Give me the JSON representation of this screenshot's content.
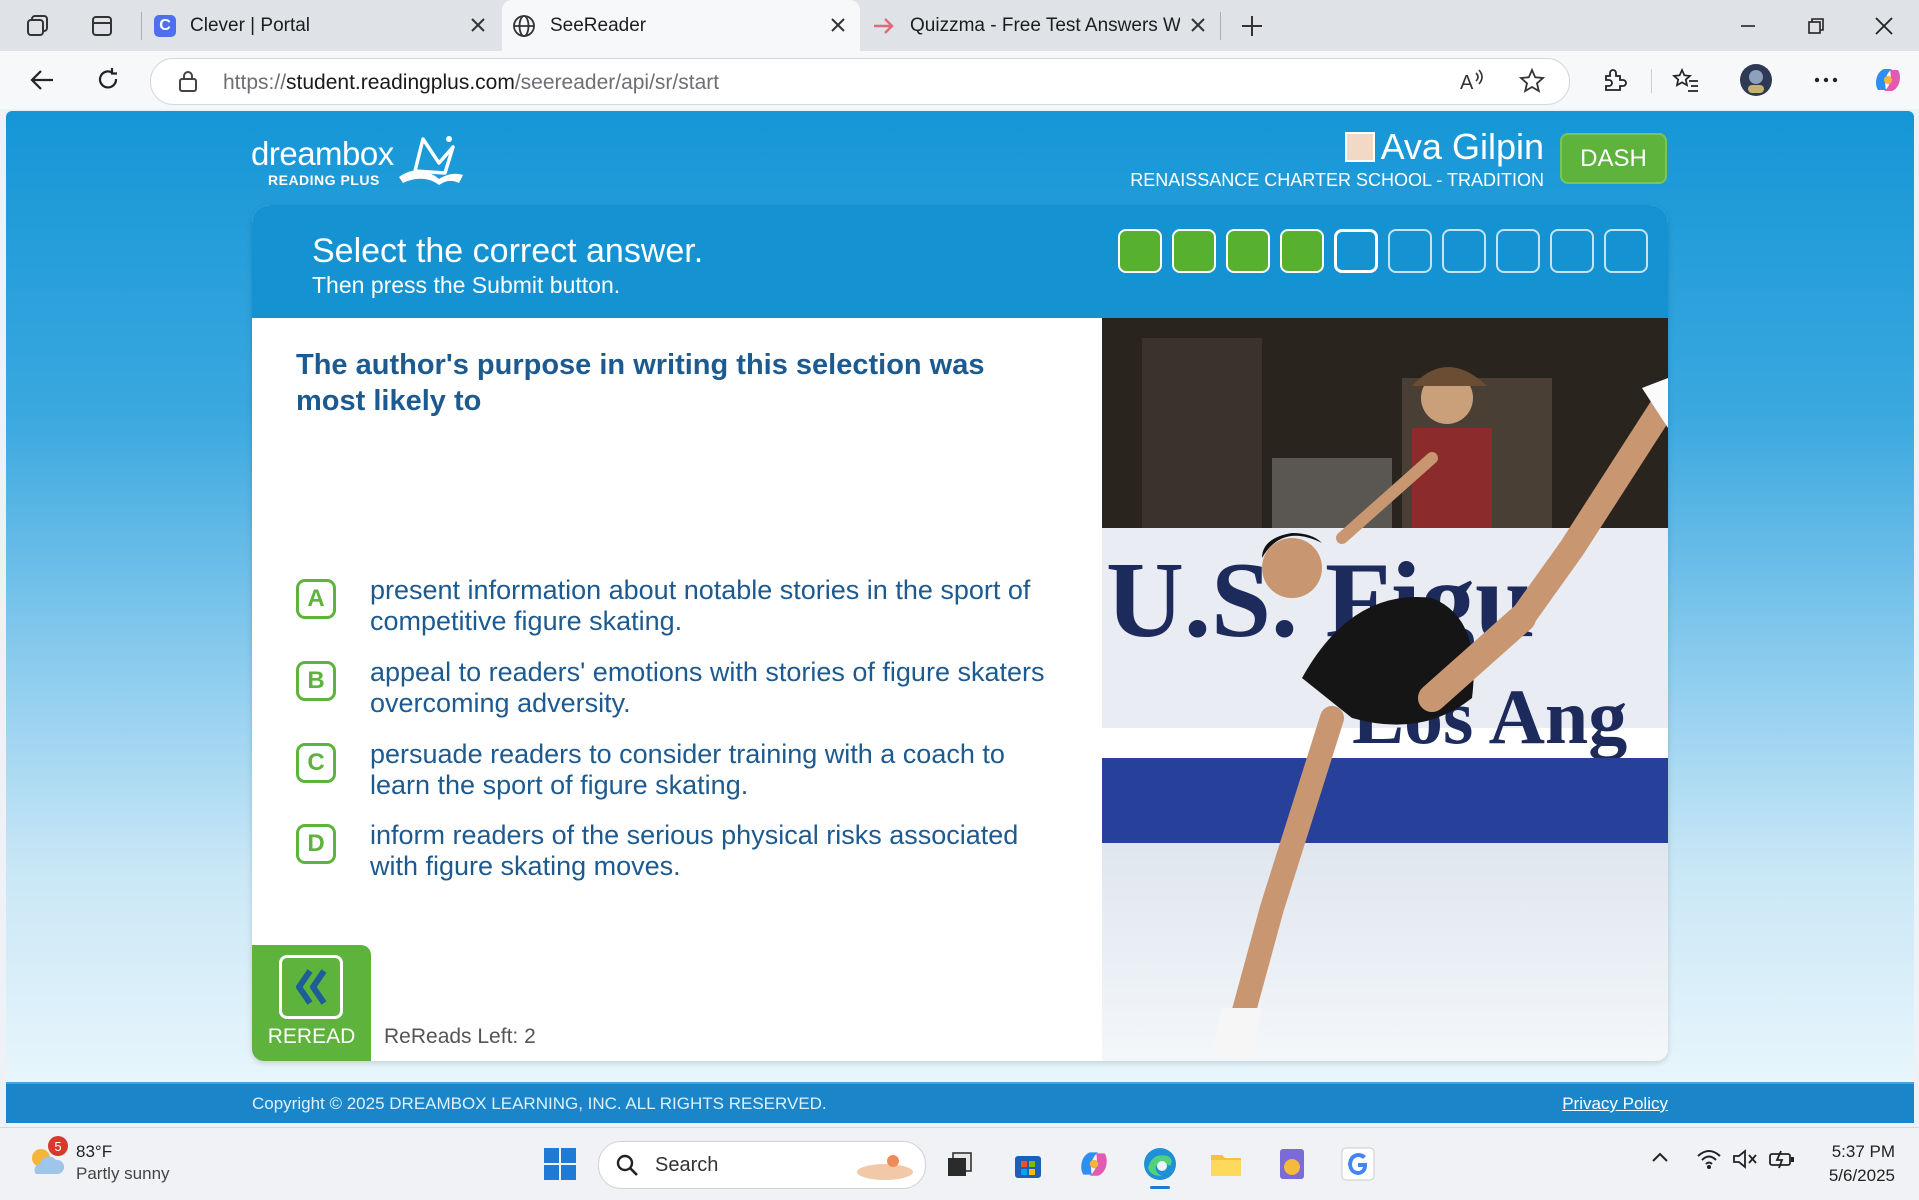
{
  "browser": {
    "tabs": [
      {
        "title": "Clever | Portal",
        "icon": "clever-icon"
      },
      {
        "title": "SeeReader",
        "icon": "globe-icon"
      },
      {
        "title": "Quizzma - Free Test Answers Web",
        "icon": "arrow-right-icon"
      }
    ],
    "url": {
      "scheme_host_prefix": "https://",
      "domain": "student.readingplus.com",
      "path": "/seereader/api/sr/start"
    }
  },
  "header": {
    "logo_word": "dreambox",
    "logo_sub": "READING PLUS",
    "user_name": "Ava Gilpin",
    "school": "RENAISSANCE CHARTER SCHOOL - TRADITION",
    "dash_label": "DASH"
  },
  "card": {
    "prompt": "Select the correct answer.",
    "instruction": "Then press the Submit button.",
    "progress": {
      "completed": 4,
      "current": 5,
      "total": 10
    }
  },
  "question": {
    "text": "The author's purpose in writing this selection was most likely to",
    "choices": [
      {
        "letter": "A",
        "text": "present information about notable stories in the sport of competitive figure skating."
      },
      {
        "letter": "B",
        "text": "appeal to readers' emotions with stories of figure skaters overcoming adversity."
      },
      {
        "letter": "C",
        "text": "persuade readers to consider training with a coach to learn the sport of figure skating."
      },
      {
        "letter": "D",
        "text": "inform readers of the serious physical risks associated with figure skating moves."
      }
    ]
  },
  "reread": {
    "label": "REREAD",
    "left_text": "ReReads Left: 2"
  },
  "photo": {
    "banner_line1": "U.S. Figu",
    "banner_line2": "Los Ang"
  },
  "footer": {
    "copyright": "Copyright © 2025 DREAMBOX LEARNING, INC. ALL RIGHTS RESERVED.",
    "privacy": "Privacy Policy"
  },
  "taskbar": {
    "weather_temp": "83°F",
    "weather_condition": "Partly sunny",
    "weather_badge": "5",
    "search_label": "Search",
    "time": "5:37 PM",
    "date": "5/6/2025"
  },
  "colors": {
    "brand_blue": "#1592d2",
    "accent_green": "#5db33b",
    "question_blue": "#1c5a90"
  }
}
